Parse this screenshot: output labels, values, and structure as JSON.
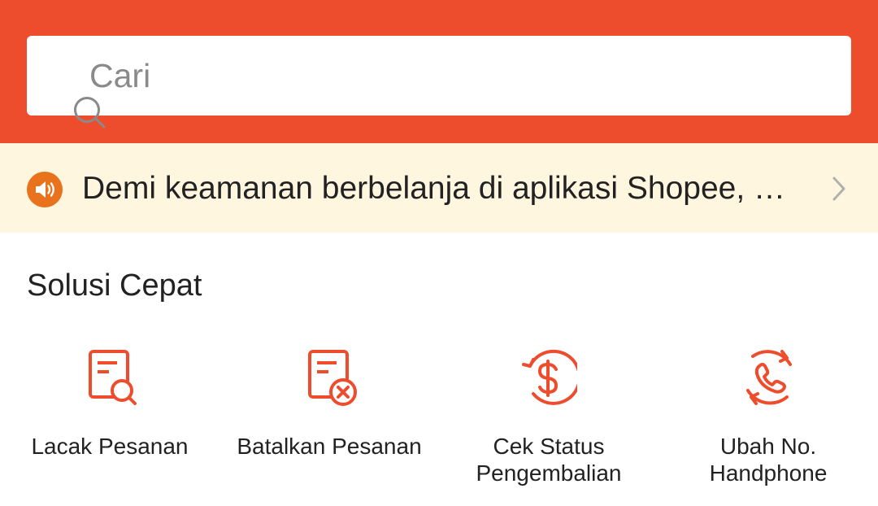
{
  "search": {
    "placeholder": "Cari"
  },
  "notice": {
    "text": "Demi keamanan berbelanja di aplikasi Shopee, mo..."
  },
  "quick_solutions": {
    "title": "Solusi Cepat",
    "items": [
      {
        "label": "Lacak Pesanan",
        "icon": "track-order-icon"
      },
      {
        "label": "Batalkan Pesanan",
        "icon": "cancel-order-icon"
      },
      {
        "label": "Cek Status\nPengembalian",
        "icon": "refund-status-icon"
      },
      {
        "label": "Ubah No.\nHandphone",
        "icon": "change-phone-icon"
      }
    ]
  },
  "colors": {
    "brand": "#ee4d2d",
    "notice_bg": "#fff6e0",
    "notice_icon": "#e8731c"
  }
}
